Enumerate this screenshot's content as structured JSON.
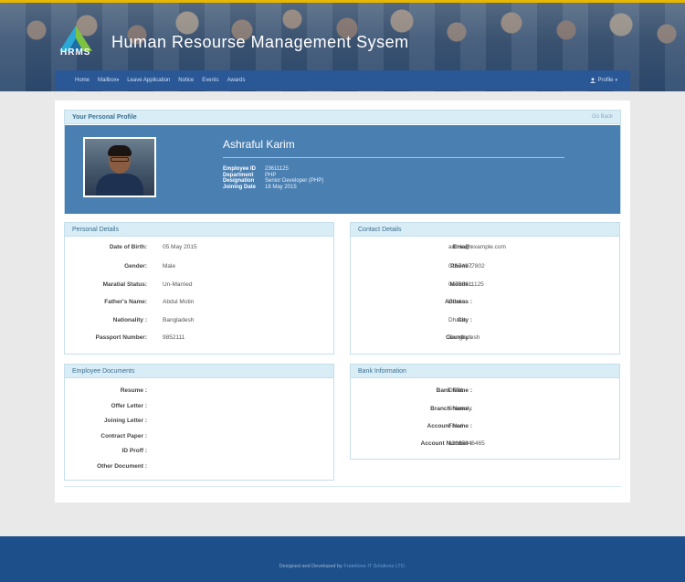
{
  "header": {
    "logo_text": "HRMS",
    "title": "Human Resourse Management Sysem"
  },
  "nav": {
    "items": [
      {
        "label": "Home",
        "caret": ""
      },
      {
        "label": "Mailbox",
        "caret": "▾"
      },
      {
        "label": "Leave Application",
        "caret": ""
      },
      {
        "label": "Notice",
        "caret": ""
      },
      {
        "label": "Events",
        "caret": ""
      },
      {
        "label": "Awards",
        "caret": ""
      }
    ],
    "profile": "Profile",
    "profile_icon": "user-icon"
  },
  "profile": {
    "heading": "Your Personal Profile",
    "go_back": "Go Back",
    "name": "Ashraful Karim",
    "info": [
      {
        "key": "Employee ID",
        "value": "23611125"
      },
      {
        "key": "Department",
        "value": "PHP"
      },
      {
        "key": "Designation",
        "value": "Senior Developer (PHP)"
      },
      {
        "key": "Joining Date",
        "value": "18 May 2015"
      }
    ]
  },
  "personal": {
    "heading": "Personal Details",
    "rows": [
      {
        "label": "Date of Birth:",
        "value": "05 May 2015"
      },
      {
        "label": "Gender:",
        "value": "Male"
      },
      {
        "label": "Maratial Status:",
        "value": "Un-Married"
      },
      {
        "label": "Father's Name:",
        "value": "Abdul Motin"
      },
      {
        "label": "Nationality :",
        "value": "Bangladesh"
      },
      {
        "label": "Passport Number:",
        "value": "9852111"
      }
    ]
  },
  "contact": {
    "heading": "Contact Details",
    "rows": [
      {
        "label": "Email :",
        "value": "admin@example.com"
      },
      {
        "label": "Phone :",
        "value": "01674977802"
      },
      {
        "label": "Mobile :",
        "value": "01723611125"
      },
      {
        "label": "Address :",
        "value": "Dhaka"
      },
      {
        "label": "City :",
        "value": "Dhaka"
      },
      {
        "label": "Country :",
        "value": "Bangladesh"
      }
    ]
  },
  "documents": {
    "heading": "Employee Documents",
    "rows": [
      {
        "label": "Resume :"
      },
      {
        "label": "Offer Letter :"
      },
      {
        "label": "Joining Letter :"
      },
      {
        "label": "Contract Paper :"
      },
      {
        "label": "ID Proff :"
      },
      {
        "label": "Other Document :"
      }
    ]
  },
  "bank": {
    "heading": "Bank Information",
    "rows": [
      {
        "label": "Bank Name :",
        "value": "DBBL"
      },
      {
        "label": "Branch Name :",
        "value": "Shamoly"
      },
      {
        "label": "Account Name :",
        "value": "Fixed"
      },
      {
        "label": "Account Number :",
        "value": "12165646465"
      }
    ]
  },
  "footer": {
    "text": "Designed and Developed by",
    "brand": "Fratellone IT Solutions LTD."
  },
  "colors": {
    "nav": "#2a5795",
    "profile_bg": "#4a7fb2",
    "panel_head": "#d9edf7",
    "footer": "#1d4f8a"
  }
}
